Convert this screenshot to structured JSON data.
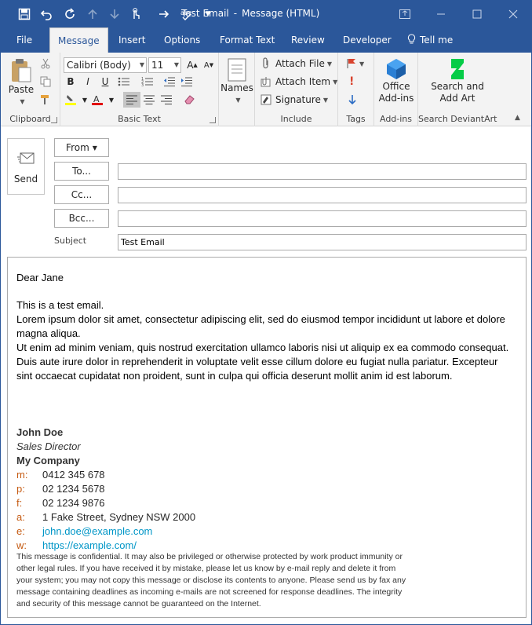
{
  "window": {
    "title": "Test Email",
    "title_sep": "-",
    "app_title": "Message (HTML)"
  },
  "tabs": [
    "File",
    "Message",
    "Insert",
    "Options",
    "Format Text",
    "Review",
    "Developer",
    "Tell me"
  ],
  "ribbon": {
    "clipboard": {
      "paste": "Paste",
      "label": "Clipboard"
    },
    "basic_text": {
      "font": "Calibri (Body)",
      "size": "11",
      "label": "Basic Text"
    },
    "names": {
      "label": "Names"
    },
    "include": {
      "attach_file": "Attach File",
      "attach_item": "Attach Item",
      "signature": "Signature",
      "label": "Include"
    },
    "tags": {
      "label": "Tags"
    },
    "addins": {
      "office_line1": "Office",
      "office_line2": "Add-ins",
      "label": "Add-ins"
    },
    "deviantart": {
      "line1": "Search and",
      "line2": "Add Art",
      "label": "Search DeviantArt"
    }
  },
  "compose": {
    "send": "Send",
    "from": "From",
    "to": "To...",
    "cc": "Cc...",
    "bcc": "Bcc...",
    "subject_label": "Subject",
    "subject_value": "Test Email",
    "to_value": "",
    "cc_value": "",
    "bcc_value": ""
  },
  "body": {
    "greeting": "Dear Jane",
    "para1": "This is a test email.",
    "para2": "Lorem ipsum dolor sit amet, consectetur adipiscing elit, sed do eiusmod tempor incididunt ut labore et dolore magna aliqua.",
    "para3": "Ut enim ad minim veniam, quis nostrud exercitation ullamco laboris nisi ut aliquip ex ea commodo consequat. Duis aute irure dolor in reprehenderit in voluptate velit esse cillum dolore eu fugiat nulla pariatur. Excepteur sint occaecat cupidatat non proident, sunt in culpa qui officia deserunt mollit anim id est laborum."
  },
  "signature": {
    "name": "John Doe",
    "title": "Sales Director",
    "company": "My Company",
    "rows": [
      {
        "k": "m:",
        "v": "0412 345 678"
      },
      {
        "k": "p:",
        "v": "02 1234 5678"
      },
      {
        "k": "f:",
        "v": "02 1234 9876"
      },
      {
        "k": "a:",
        "v": "1 Fake Street, Sydney NSW 2000"
      },
      {
        "k": "e:",
        "v": "john.doe@example.com"
      },
      {
        "k": "w:",
        "v": "https://example.com/"
      }
    ],
    "disclaimer": "This message is confidential. It may also be privileged or otherwise protected by work product immunity or other legal rules. If you have received it by mistake, please let us know by e-mail reply and delete it from your system; you may not copy this message or disclose its contents to anyone. Please send us by fax any message containing deadlines as incoming e-mails are not screened for response deadlines. The integrity and security of this message cannot be guaranteed on the Internet."
  },
  "colors": {
    "accent": "#2b579a",
    "signature_key": "#c55a11",
    "link": "#0096c7"
  }
}
